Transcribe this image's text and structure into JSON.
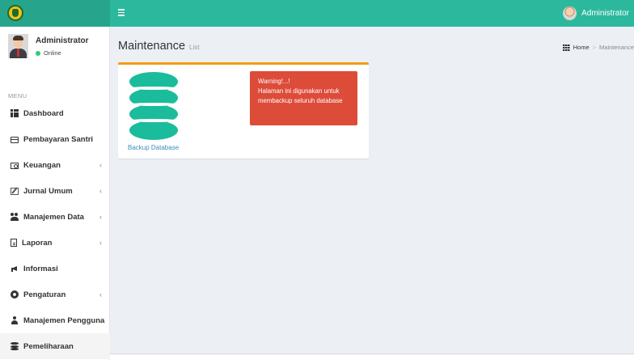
{
  "header": {
    "user_name": "Administrator",
    "colors": {
      "topbar": "#2cb89d",
      "logo_bg": "#26a58c"
    }
  },
  "sidebar": {
    "user": {
      "name": "Administrator",
      "status": "Online"
    },
    "menu_header": "MENU",
    "items": [
      {
        "label": "Dashboard",
        "icon": "th-grid-icon",
        "has_children": false
      },
      {
        "label": "Pembayaran Santri",
        "icon": "credit-card-icon",
        "has_children": false
      },
      {
        "label": "Keuangan",
        "icon": "money-icon",
        "has_children": true
      },
      {
        "label": "Jurnal Umum",
        "icon": "edit-icon",
        "has_children": true
      },
      {
        "label": "Manajemen Data",
        "icon": "users-icon",
        "has_children": true
      },
      {
        "label": "Laporan",
        "icon": "file-icon",
        "has_children": true
      },
      {
        "label": "Informasi",
        "icon": "bullhorn-icon",
        "has_children": false
      },
      {
        "label": "Pengaturan",
        "icon": "gear-icon",
        "has_children": true
      },
      {
        "label": "Manajemen Pengguna",
        "icon": "user-icon",
        "has_children": false
      },
      {
        "label": "Pemeliharaan",
        "icon": "database-icon",
        "has_children": false,
        "active": true
      }
    ],
    "chevron": "‹"
  },
  "page": {
    "title": "Maintenance",
    "subtitle": "List",
    "breadcrumb": {
      "home": "Home",
      "separator": ">",
      "current": "Maintenance"
    }
  },
  "box": {
    "accent_color": "#f39c12",
    "backup_label": "Backup Database",
    "icon_color": "#1abc9c",
    "callout": {
      "color": "#dd4b39",
      "line1": "Warning!...!",
      "line2": "Halaman ini digunakan untuk",
      "line3": "membackup seluruh database"
    }
  }
}
